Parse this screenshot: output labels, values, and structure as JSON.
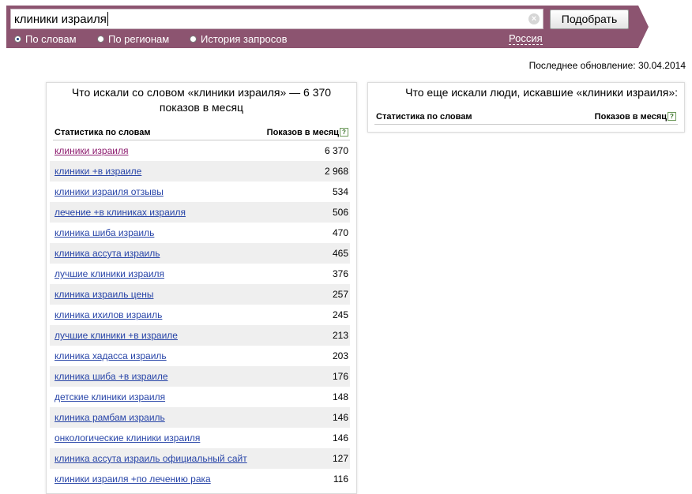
{
  "search": {
    "query": "клиники израиля",
    "clear_symbol": "×",
    "submit_label": "Подобрать"
  },
  "modes": [
    {
      "label": "По словам",
      "selected": true
    },
    {
      "label": "По регионам",
      "selected": false
    },
    {
      "label": "История запросов",
      "selected": false
    }
  ],
  "region": "Россия",
  "last_update": "Последнее обновление: 30.04.2014",
  "left_panel": {
    "title": "Что искали со словом «клиники израиля» — 6 370 показов в месяц",
    "col_phrase": "Статистика по словам",
    "col_count": "Показов в месяц",
    "help": "?",
    "rows": [
      {
        "phrase": "клиники израиля",
        "count": "6 370"
      },
      {
        "phrase": "клиники +в израиле",
        "count": "2 968"
      },
      {
        "phrase": "клиники израиля отзывы",
        "count": "534"
      },
      {
        "phrase": "лечение +в клиниках израиля",
        "count": "506"
      },
      {
        "phrase": "клиника шиба израиль",
        "count": "470"
      },
      {
        "phrase": "клиника ассута израиль",
        "count": "465"
      },
      {
        "phrase": "лучшие клиники израиля",
        "count": "376"
      },
      {
        "phrase": "клиника израиль цены",
        "count": "257"
      },
      {
        "phrase": "клиника ихилов израиль",
        "count": "245"
      },
      {
        "phrase": "лучшие клиники +в израиле",
        "count": "213"
      },
      {
        "phrase": "клиника хадасса израиль",
        "count": "203"
      },
      {
        "phrase": "клиника шиба +в израиле",
        "count": "176"
      },
      {
        "phrase": "детские клиники израиля",
        "count": "148"
      },
      {
        "phrase": "клиника рамбам израиль",
        "count": "146"
      },
      {
        "phrase": "онкологические клиники израиля",
        "count": "146"
      },
      {
        "phrase": "клиника ассута израиль официальный сайт",
        "count": "127"
      },
      {
        "phrase": "клиники израиля +по лечению рака",
        "count": "116"
      }
    ]
  },
  "right_panel": {
    "title": "Что еще искали люди, искавшие «клиники израиля»:",
    "col_phrase": "Статистика по словам",
    "col_count": "Показов в месяц",
    "help": "?"
  }
}
